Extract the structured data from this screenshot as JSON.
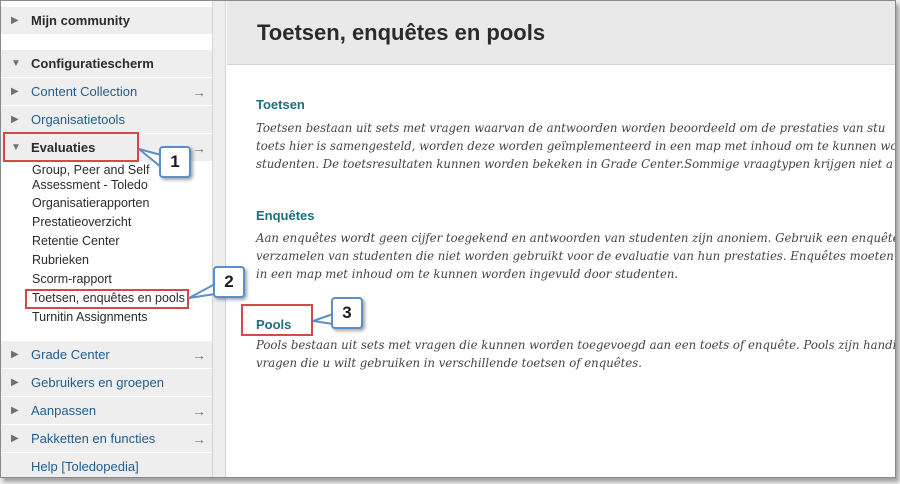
{
  "sidebar": {
    "community": "Mijn community",
    "control_panel": "Configuratiescherm",
    "content_collection": "Content Collection",
    "org_tools": "Organisatietools",
    "evaluations": "Evaluaties",
    "eval_items": [
      "Group, Peer and Self",
      "Assessment - Toledo",
      "Organisatierapporten",
      "Prestatieoverzicht",
      "Retentie Center",
      "Rubrieken",
      "Scorm-rapport",
      "Toetsen, enquêtes en pools",
      "Turnitin Assignments"
    ],
    "grade_center": "Grade Center",
    "users_groups": "Gebruikers en groepen",
    "customize": "Aanpassen",
    "packages": "Pakketten en functies",
    "help": "Help [Toledopedia]"
  },
  "main": {
    "title": "Toetsen, enquêtes en pools",
    "sections": [
      {
        "title": "Toetsen",
        "lines": [
          "Toetsen bestaan uit sets met vragen waarvan de antwoorden worden beoordeeld om de prestaties van stu",
          "toets hier is samengesteld, worden deze worden geïmplementeerd in een map met inhoud om te kunnen wo",
          "studenten. De toetsresultaten kunnen worden bekeken in Grade Center.Sommige vraagtypen krijgen niet a"
        ]
      },
      {
        "title": "Enquêtes",
        "lines": [
          "Aan enquêtes wordt geen cijfer toegekend en antwoorden van studenten zijn anoniem. Gebruik een enquête",
          "verzamelen van studenten die niet worden gebruikt voor de evaluatie van hun prestaties. Enquêtes moeten",
          "in een map met inhoud om te kunnen worden ingevuld door studenten."
        ]
      },
      {
        "title": "Pools",
        "lines": [
          "Pools bestaan uit sets met vragen die kunnen worden toegevoegd aan een toets of enquête. Pools zijn handi",
          "vragen die u wilt gebruiken in verschillende toetsen of enquêtes."
        ]
      }
    ]
  },
  "annotations": {
    "callout1": "1",
    "callout2": "2",
    "callout3": "3"
  },
  "icons": {
    "collapsed": "triangle-right",
    "expanded": "triangle-down",
    "go": "arrow-right"
  },
  "colors": {
    "link": "#225d8e",
    "section_title": "#1f6d7f",
    "highlight": "#d64747",
    "callout_border": "#5a8fc8"
  }
}
